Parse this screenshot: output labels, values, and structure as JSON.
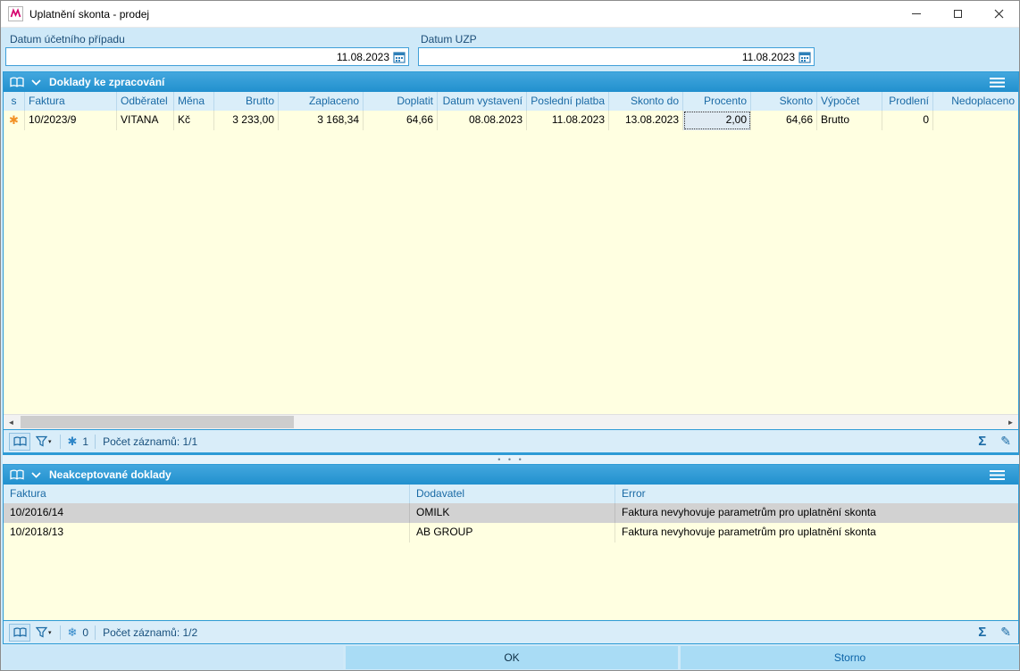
{
  "window": {
    "title": "Uplatnění skonta - prodej"
  },
  "form": {
    "fields": [
      {
        "label": "Datum účetního případu",
        "value": "11.08.2023"
      },
      {
        "label": "Datum UZP",
        "value": "11.08.2023"
      }
    ]
  },
  "panel1": {
    "title": "Doklady ke zpracování",
    "columns": [
      "s",
      "Faktura",
      "Odběratel",
      "Měna",
      "Brutto",
      "Zaplaceno",
      "Doplatit",
      "Datum vystavení",
      "Poslední platba",
      "Skonto do",
      "Procento",
      "Skonto",
      "Výpočet",
      "Prodlení",
      "Nedoplaceno"
    ],
    "row": [
      "10/2023/9",
      "VITANA",
      "Kč",
      "3 233,00",
      "3 168,34",
      "64,66",
      "08.08.2023",
      "11.08.2023",
      "13.08.2023",
      "2,00",
      "64,66",
      "Brutto",
      "0",
      ""
    ],
    "badge_count": "1",
    "records_label": "Počet záznamů: 1/1"
  },
  "panel2": {
    "title": "Neakceptované doklady",
    "columns": [
      "Faktura",
      "Dodavatel",
      "Error"
    ],
    "rows": [
      [
        "10/2016/14",
        "OMILK",
        "Faktura nevyhovuje parametrům pro uplatnění skonta"
      ],
      [
        "10/2018/13",
        "AB GROUP",
        "Faktura nevyhovuje parametrům pro uplatnění skonta"
      ]
    ],
    "badge_count": "0",
    "records_label": "Počet záznamů: 1/2"
  },
  "buttons": {
    "ok": "OK",
    "storno": "Storno"
  },
  "icons": {
    "row_marker": "✱",
    "panel1_badge": "✱",
    "panel2_badge": "❄",
    "sum": "Σ",
    "edit": "✎",
    "scroll_left": "◄",
    "scroll_right": "►",
    "splitter_dots": "• • •",
    "filter_caret": "▾"
  },
  "colors": {
    "accent_blue": "#2e9bd6",
    "grid_yellow": "#ffffe1",
    "selected_row_gray": "#d2d2d2",
    "marker_orange": "#f29126"
  }
}
